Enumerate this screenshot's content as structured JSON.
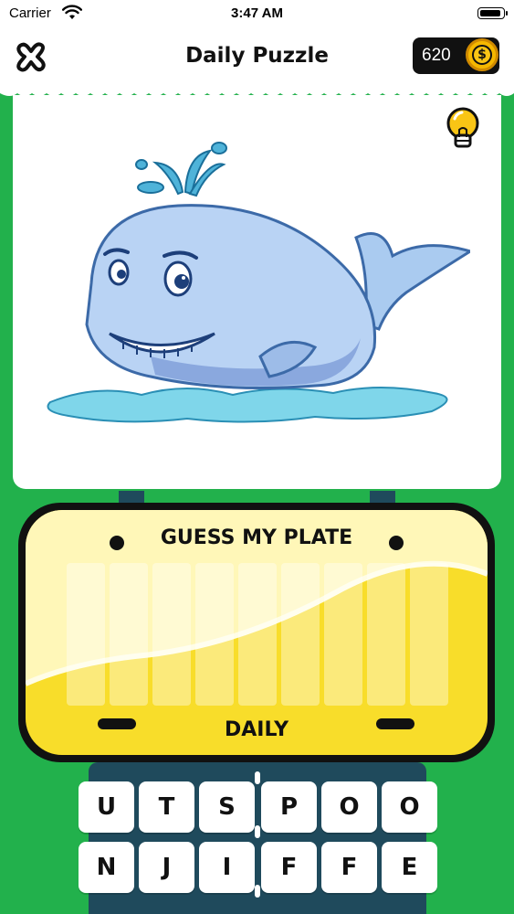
{
  "status_bar": {
    "carrier": "Carrier",
    "time": "3:47 AM"
  },
  "header": {
    "title": "Daily Puzzle",
    "coins": "620",
    "coin_symbol": "$"
  },
  "icons": {
    "close": "close-x-icon",
    "hint": "lightbulb-icon",
    "coin": "coin-icon",
    "wifi": "wifi-icon",
    "battery": "battery-icon"
  },
  "puzzle_image": "cartoon-whale",
  "plate": {
    "label": "GUESS MY PLATE",
    "footer": "DAILY",
    "answer_slots": 9
  },
  "keyboard": {
    "row1": [
      "U",
      "T",
      "S",
      "P",
      "O",
      "O"
    ],
    "row2": [
      "N",
      "J",
      "I",
      "F",
      "F",
      "E"
    ]
  },
  "colors": {
    "background": "#22b14c",
    "plate_fill": "#f8dd2a",
    "key": "#ffffff",
    "pillar": "#1f4a5c"
  }
}
